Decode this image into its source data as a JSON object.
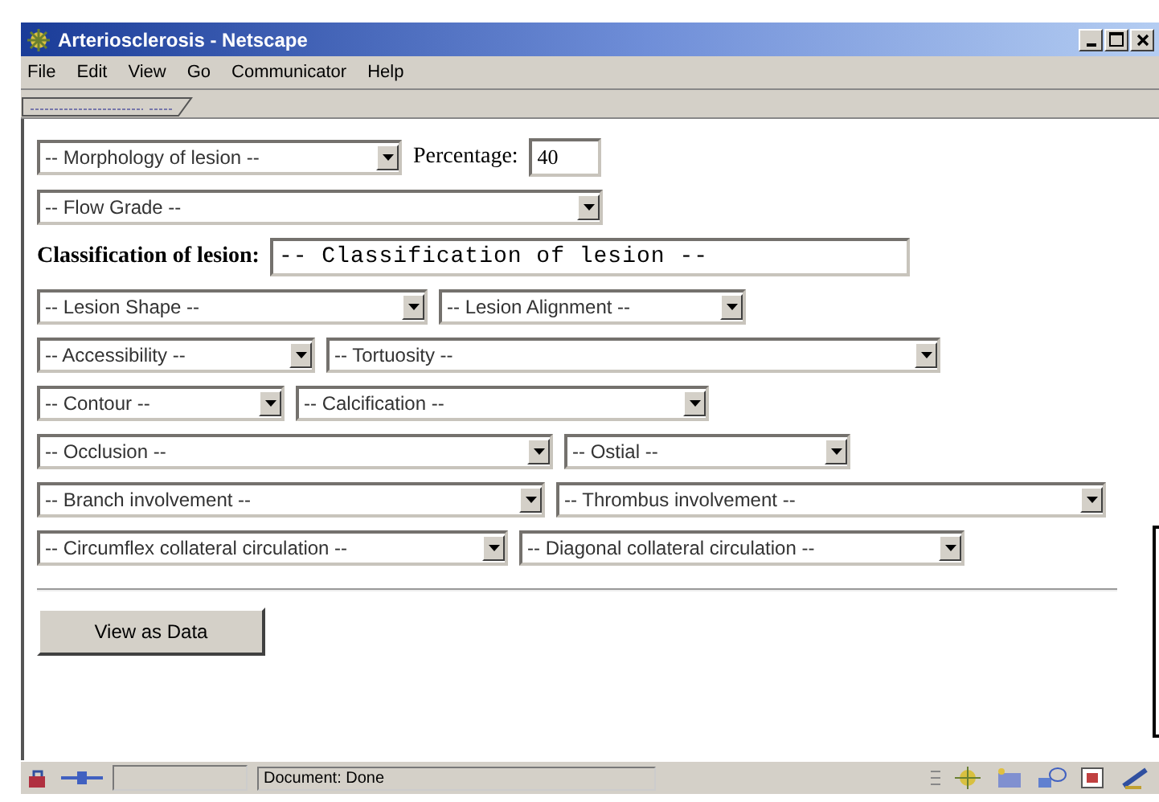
{
  "window": {
    "title": "Arteriosclerosis - Netscape"
  },
  "menu": [
    "File",
    "Edit",
    "View",
    "Go",
    "Communicator",
    "Help"
  ],
  "form": {
    "rows": [
      {
        "items": [
          {
            "kind": "dropdown",
            "value": "-- Morphology of lesion --"
          },
          {
            "kind": "label",
            "text": "Percentage:"
          },
          {
            "kind": "input",
            "value": "40"
          }
        ]
      },
      {
        "items": [
          {
            "kind": "dropdown",
            "value": "-- Flow Grade --"
          }
        ]
      },
      {
        "items": [
          {
            "kind": "bold_label",
            "text": "Classification of lesion:"
          },
          {
            "kind": "mono_input",
            "value": "-- Classification of lesion --"
          }
        ]
      },
      {
        "items": [
          {
            "kind": "dropdown",
            "value": "-- Lesion Shape --"
          },
          {
            "kind": "dropdown",
            "value": "-- Lesion Alignment --"
          }
        ]
      },
      {
        "items": [
          {
            "kind": "dropdown",
            "value": "-- Accessibility --"
          },
          {
            "kind": "dropdown",
            "value": "-- Tortuosity --"
          }
        ]
      },
      {
        "items": [
          {
            "kind": "dropdown",
            "value": "-- Contour --"
          },
          {
            "kind": "dropdown",
            "value": "-- Calcification --"
          }
        ]
      },
      {
        "items": [
          {
            "kind": "dropdown",
            "value": "-- Occlusion --"
          },
          {
            "kind": "dropdown",
            "value": "-- Ostial --"
          }
        ]
      },
      {
        "items": [
          {
            "kind": "dropdown",
            "value": "-- Branch involvement --"
          },
          {
            "kind": "dropdown",
            "value": "-- Thrombus involvement --"
          }
        ]
      },
      {
        "items": [
          {
            "kind": "dropdown",
            "value": "-- Circumflex collateral circulation --"
          },
          {
            "kind": "dropdown",
            "value": "-- Diagonal collateral circulation --"
          }
        ]
      }
    ],
    "button": "View as Data"
  },
  "status_bar": {
    "text": "Document: Done"
  }
}
